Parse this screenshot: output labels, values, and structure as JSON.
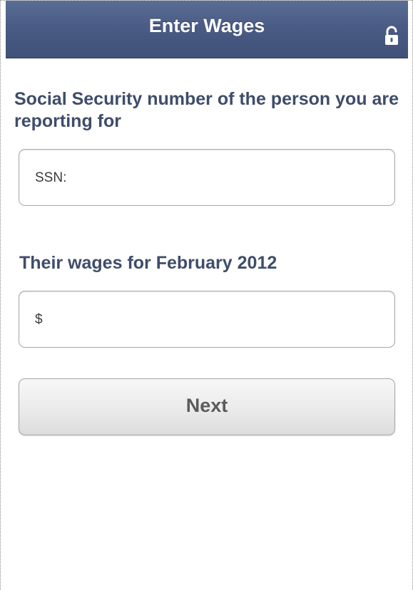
{
  "header": {
    "title": "Enter Wages",
    "lock_icon": "unlocked-padlock-icon"
  },
  "form": {
    "ssn_label": "Social Security number of the person you are reporting for",
    "ssn_field_text": "SSN:",
    "wages_label": "Their wages for February 2012",
    "wages_field_text": "$",
    "next_label": "Next"
  },
  "colors": {
    "header": "#4a5c85",
    "label": "#3f4c6b",
    "button": "#ececec"
  }
}
